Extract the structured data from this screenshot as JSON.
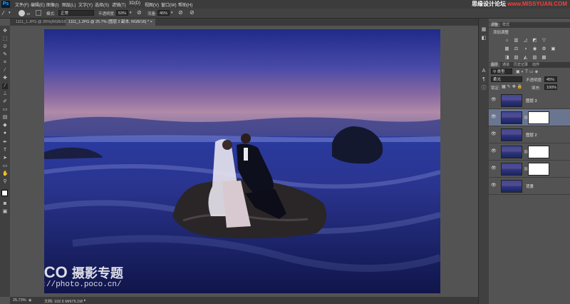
{
  "app": {
    "logo": "Ps"
  },
  "menu": [
    "文件(F)",
    "编辑(E)",
    "图像(I)",
    "图层(L)",
    "文字(Y)",
    "选择(S)",
    "滤镜(T)",
    "3D(D)",
    "视图(V)",
    "窗口(W)",
    "帮助(H)"
  ],
  "site_watermark": {
    "part1": "思缘设计论坛",
    "part2": " www.MISSYUAN.COM"
  },
  "options": {
    "brush_size": "10",
    "mode_label": "模式:",
    "mode_value": "正常",
    "opacity_label": "不透明度:",
    "opacity_value": "53%",
    "flow_label": "流量:",
    "flow_value": "45%"
  },
  "tabs": [
    {
      "label": "1111_1.JPG @ 25%(RGB/16)",
      "active": false
    },
    {
      "label": "1111_1.JPG @ 25.7% (图层 2 副本, RGB/16) *",
      "active": true
    }
  ],
  "status": {
    "zoom": "25.73%",
    "doc": "文档: 102.5 M/675.1M"
  },
  "photo_watermark": {
    "brand": "POCO",
    "title": "摄影专题",
    "url": "http://photo.poco.cn/"
  },
  "panels": {
    "adjust_tabs": [
      "调整",
      "样式"
    ],
    "adjust_title": "添加调整",
    "layer_tabs": [
      "图层",
      "通道",
      "历史记录",
      "动作"
    ],
    "kind_label": "类型",
    "blend_mode": "柔光",
    "opacity_label": "不透明度:",
    "opacity_value": "45%",
    "lock_label": "锁定:",
    "fill_label": "填充:",
    "fill_value": "100%",
    "layers": [
      {
        "name": "图层 3",
        "has_mask": false,
        "selected": false
      },
      {
        "name": "",
        "has_mask": true,
        "selected": true
      },
      {
        "name": "图层 2",
        "has_mask": false,
        "selected": false
      },
      {
        "name": "",
        "has_mask": true,
        "selected": false
      },
      {
        "name": "",
        "has_mask": true,
        "selected": false
      },
      {
        "name": "背景",
        "has_mask": false,
        "selected": false
      }
    ]
  },
  "colors": {
    "ui_dark": "#3c3c3c",
    "ui_mid": "#535353",
    "selection": "#6a7590",
    "sky_top": "#2a2f8a",
    "sea": "#1a2070"
  }
}
